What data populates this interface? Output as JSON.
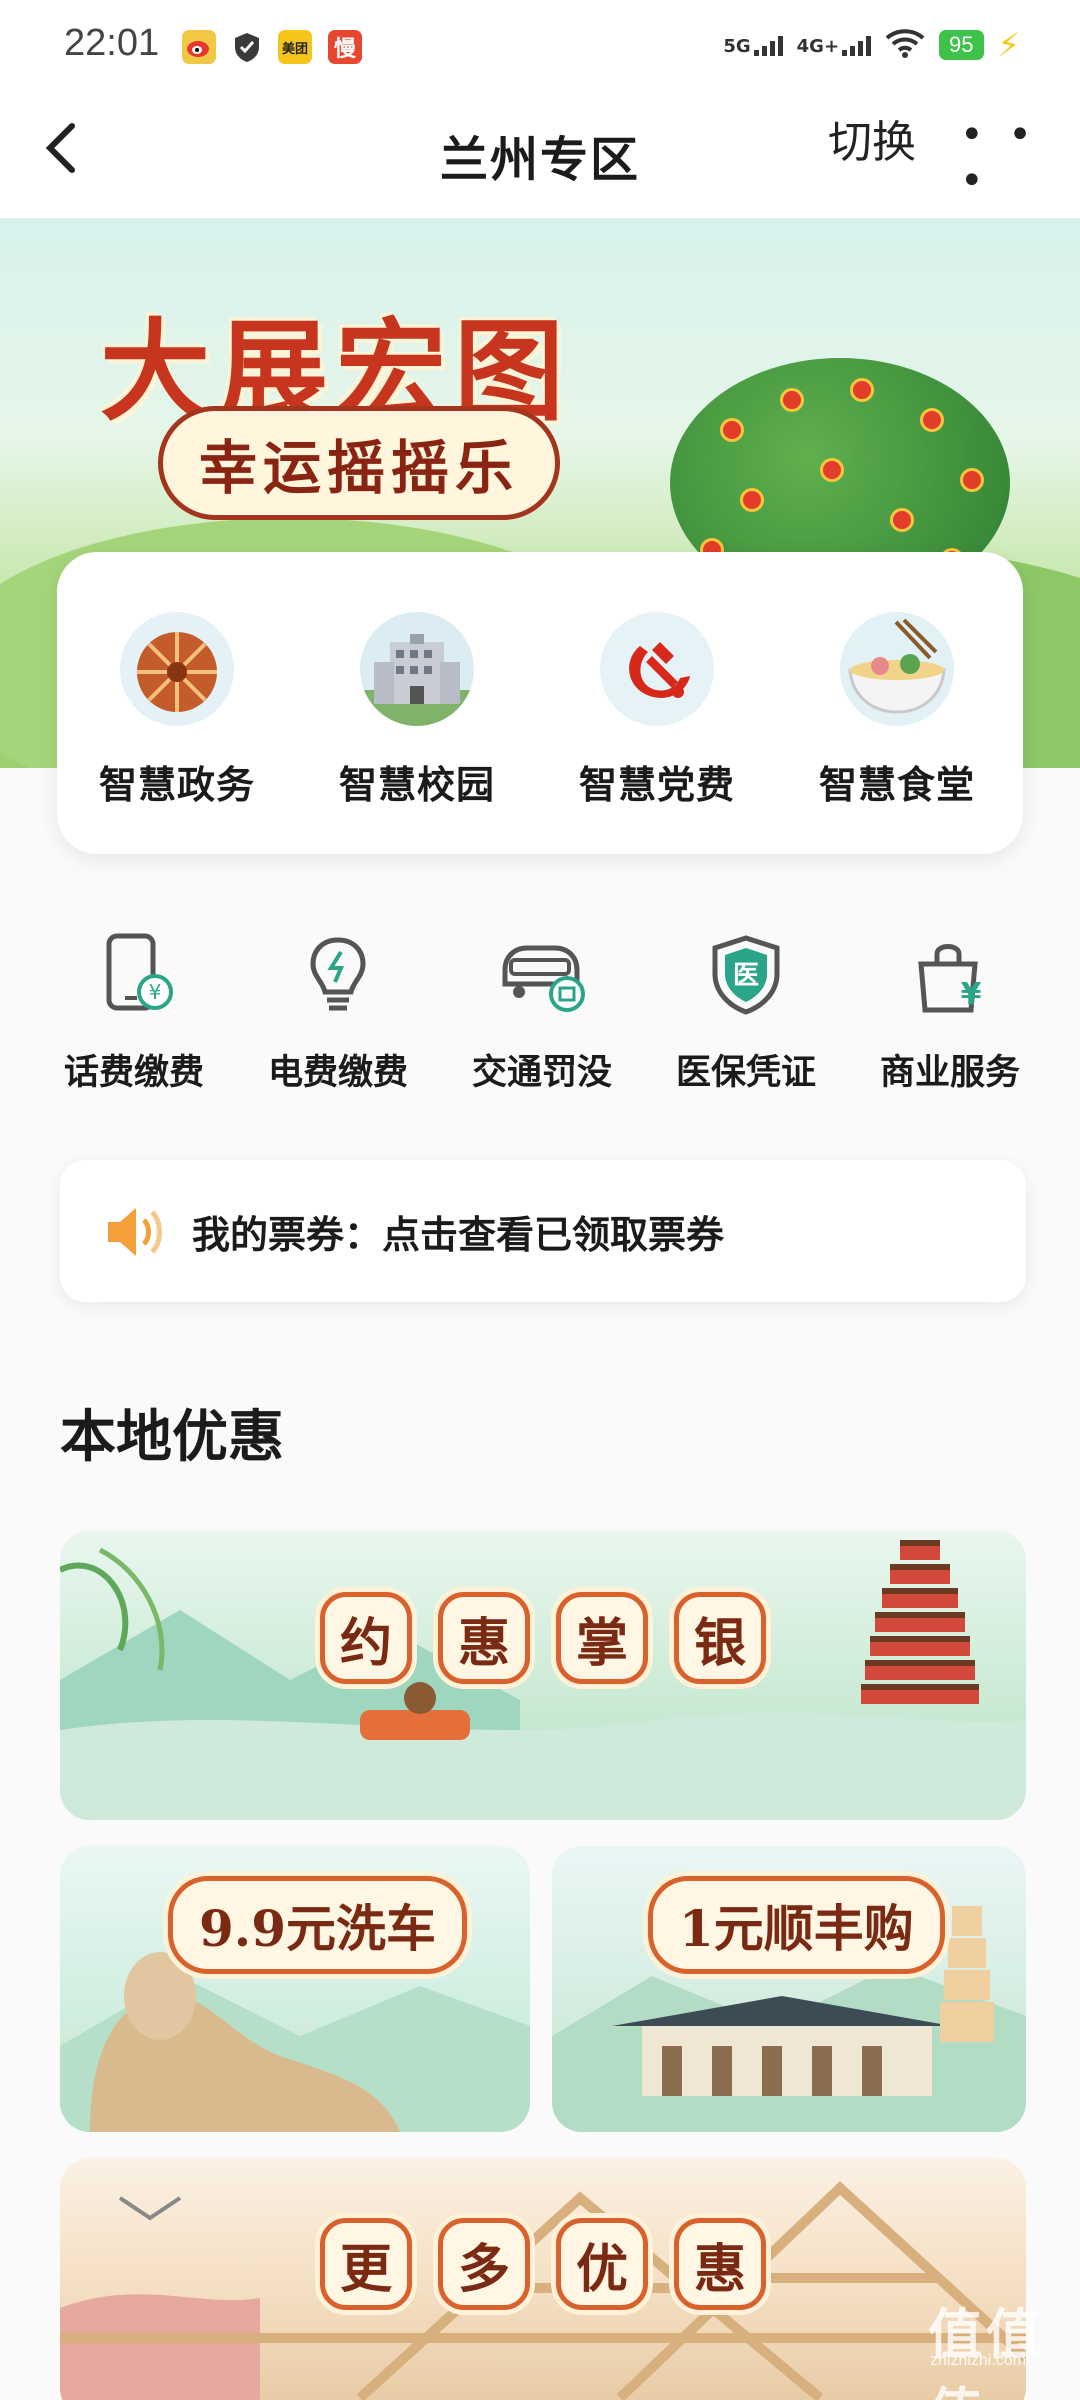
{
  "status_bar": {
    "time": "22:01",
    "app_icons": [
      "weibo-icon",
      "shield-icon",
      "meituan-icon",
      "man-icon"
    ],
    "meituan_label": "美团",
    "man_label": "慢",
    "signal_5g": "5G",
    "signal_4g": "4G+",
    "battery": "95"
  },
  "nav": {
    "title": "兰州专区",
    "switch_label": "切换",
    "more_label": "• • •"
  },
  "banner": {
    "title": "大展宏图",
    "subtitle": "幸运摇摇乐"
  },
  "smart_services": [
    {
      "label": "智慧政务",
      "icon": "government-icon"
    },
    {
      "label": "智慧校园",
      "icon": "campus-icon"
    },
    {
      "label": "智慧党费",
      "icon": "party-fee-icon"
    },
    {
      "label": "智慧食堂",
      "icon": "canteen-icon"
    }
  ],
  "services": [
    {
      "label": "话费缴费",
      "icon": "phone-bill-icon"
    },
    {
      "label": "电费缴费",
      "icon": "electricity-bill-icon"
    },
    {
      "label": "交通罚没",
      "icon": "traffic-fine-icon"
    },
    {
      "label": "医保凭证",
      "icon": "medical-insurance-icon"
    },
    {
      "label": "商业服务",
      "icon": "business-service-icon"
    }
  ],
  "ticket": {
    "text": "我的票券：点击查看已领取票券"
  },
  "local_offers": {
    "title": "本地优惠",
    "main_chars": [
      "约",
      "惠",
      "掌",
      "银"
    ],
    "car_wash": "9.9元洗车",
    "sf_buy": "1元顺丰购",
    "more_chars": [
      "更",
      "多",
      "优",
      "惠"
    ]
  },
  "watermark": {
    "text": "zhizhizhi.com",
    "logo_text": "值值值"
  },
  "colors": {
    "accent_red": "#c7351f",
    "frame_orange": "#d9612b",
    "service_green": "#2aa58a"
  }
}
